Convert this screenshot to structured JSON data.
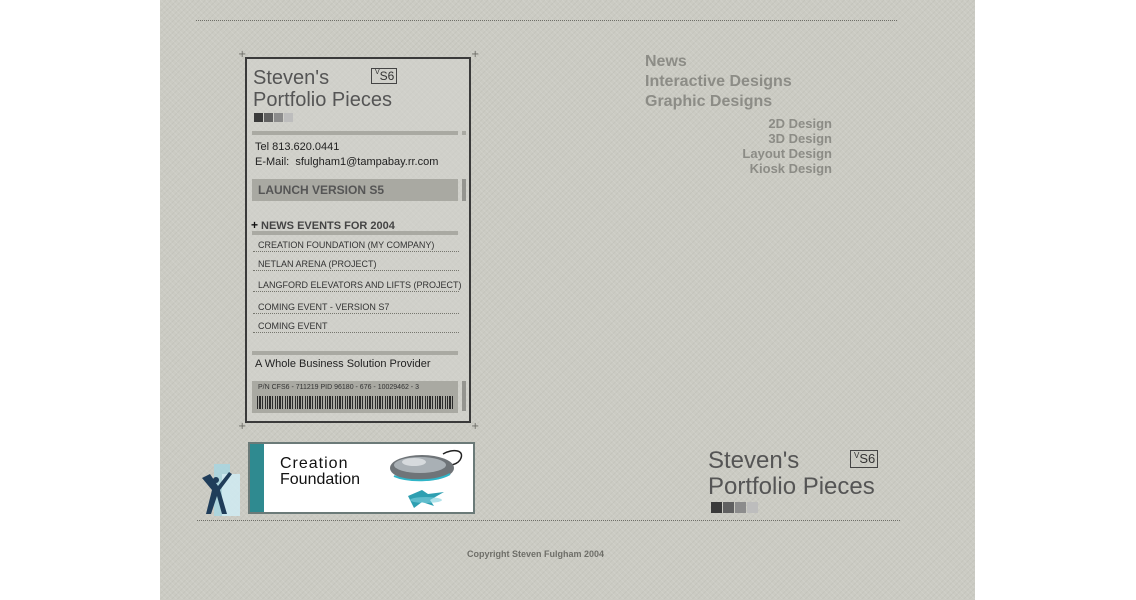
{
  "card": {
    "title_line1": "Steven's",
    "title_line2": "Portfolio Pieces",
    "version_sup": "V",
    "version": "S6",
    "tel": "Tel 813.620.0441",
    "email_label": "E-Mail:",
    "email": "sfulgham1@tampabay.rr.com",
    "launch_label": "LAUNCH VERSION S5",
    "news_toggle": "+",
    "news_heading": "NEWS EVENTS FOR 2004",
    "news_items": [
      "CREATION FOUNDATION (MY COMPANY)",
      "NETLAN ARENA (PROJECT)",
      "LANGFORD ELEVATORS AND LIFTS (PROJECT)",
      "COMING EVENT - VERSION S7",
      "COMING EVENT"
    ],
    "tagline": "A Whole Business Solution Provider",
    "part_number": "P/N CFS6 - 711219 PID 96180 - 676 - 10029462 - 3"
  },
  "nav": {
    "main": [
      "News",
      "Interactive Designs",
      "Graphic Designs"
    ],
    "sub": [
      "2D Design",
      "3D Design",
      "Layout Design",
      "Kiosk Design"
    ]
  },
  "logo": {
    "title_line1": "Steven's",
    "title_line2": "Portfolio Pieces",
    "version_sup": "V",
    "version": "S6"
  },
  "banner": {
    "line1": "Creation",
    "line2": "Foundation"
  },
  "copyright": "Copyright Steven Fulgham 2004",
  "colors": {
    "background": "#cbcbc3",
    "swatches": [
      "#3a3a3a",
      "#606060",
      "#8c8c8c",
      "#bdbdbd"
    ],
    "nav_text": "#8c8c86",
    "banner_accent": "#2f8a90"
  }
}
